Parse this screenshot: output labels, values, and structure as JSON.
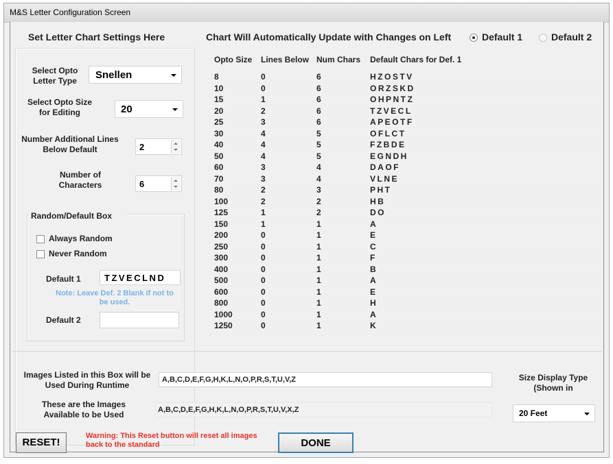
{
  "window": {
    "title": "M&S Letter Configuration Screen"
  },
  "left_panel": {
    "heading": "Set Letter Chart Settings Here",
    "opto_letter_type": {
      "label": "Select Opto Letter Type",
      "value": "Snellen"
    },
    "opto_size_editing": {
      "label": "Select Opto Size for Editing",
      "value": "20"
    },
    "additional_lines": {
      "label": "Number Additional Lines Below Default",
      "value": "2"
    },
    "num_characters": {
      "label": "Number of Characters",
      "value": "6"
    },
    "random_box": {
      "title": "Random/Default Box",
      "always_random": "Always Random",
      "never_random": "Never Random",
      "default1_label": "Default 1",
      "default1_value": "TZVECLND",
      "note": "Note: Leave Def. 2 Blank if not to be used.",
      "default2_label": "Default 2",
      "default2_value": ""
    }
  },
  "chart_header": {
    "text": "Chart Will Automatically Update with Changes on Left",
    "radio_default1": "Default 1",
    "radio_default2": "Default 2"
  },
  "table": {
    "columns": [
      "Opto Size",
      "Lines Below",
      "Num Chars",
      "Default Chars for Def. 1"
    ],
    "rows": [
      [
        "8",
        "0",
        "6",
        "HZOSTV"
      ],
      [
        "10",
        "0",
        "6",
        "ORZSKD"
      ],
      [
        "15",
        "1",
        "6",
        "OHPNTZ"
      ],
      [
        "20",
        "2",
        "6",
        "TZVECL"
      ],
      [
        "25",
        "3",
        "6",
        "APEOTF"
      ],
      [
        "30",
        "4",
        "5",
        "OFLCT"
      ],
      [
        "40",
        "4",
        "5",
        "FZBDE"
      ],
      [
        "50",
        "4",
        "5",
        "EGNDH"
      ],
      [
        "60",
        "3",
        "4",
        "DAOF"
      ],
      [
        "70",
        "3",
        "4",
        "VLNE"
      ],
      [
        "80",
        "2",
        "3",
        "PHT"
      ],
      [
        "100",
        "2",
        "2",
        "HB"
      ],
      [
        "125",
        "1",
        "2",
        "DO"
      ],
      [
        "150",
        "1",
        "1",
        "A"
      ],
      [
        "200",
        "0",
        "1",
        "E"
      ],
      [
        "250",
        "0",
        "1",
        "C"
      ],
      [
        "300",
        "0",
        "1",
        "F"
      ],
      [
        "400",
        "0",
        "1",
        "B"
      ],
      [
        "500",
        "0",
        "1",
        "A"
      ],
      [
        "600",
        "0",
        "1",
        "E"
      ],
      [
        "800",
        "0",
        "1",
        "H"
      ],
      [
        "1000",
        "0",
        "1",
        "A"
      ],
      [
        "1250",
        "0",
        "1",
        "K"
      ]
    ]
  },
  "bottom": {
    "images_runtime_label": "Images Listed in this Box will be Used During Runtime",
    "images_runtime_value": "A,B,C,D,E,F,G,H,K,L,N,O,P,R,S,T,U,V,Z",
    "images_available_label": "These are the Images Available to be Used",
    "images_available_value": "A,B,C,D,E,F,G,H,K,L,N,O,P,R,S,T,U,V,X,Z",
    "size_display_label": "Size Display Type (Shown in",
    "size_display_value": "20 Feet",
    "reset_button": "RESET!",
    "warning": "Warning: This Reset button will reset all images back to the standard",
    "done_button": "DONE"
  },
  "colors": {
    "warning": "#e8322a",
    "note": "#79b4ea",
    "done_border": "#3c7fb1"
  }
}
